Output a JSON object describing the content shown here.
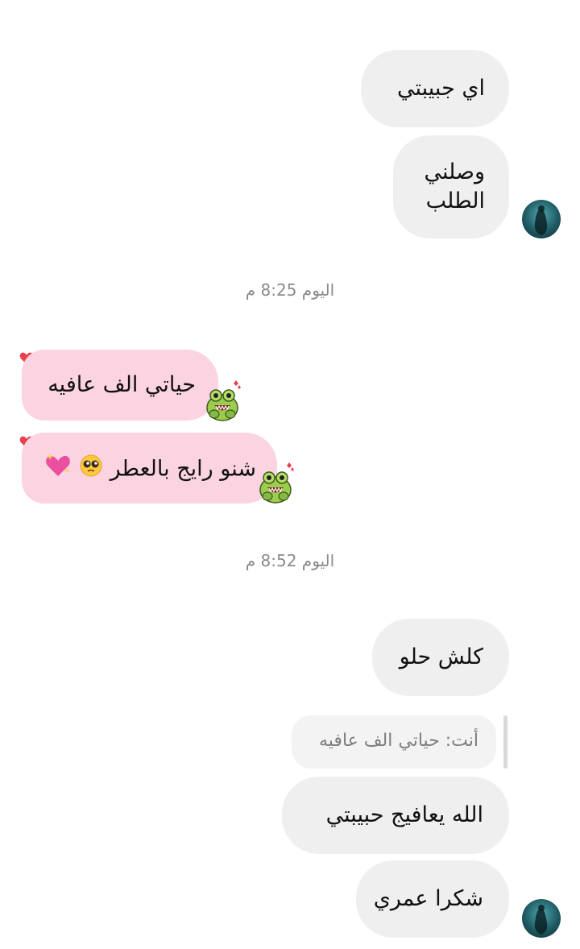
{
  "messages": [
    {
      "text": "اي جبيبتي"
    },
    {
      "line1": "وصلني",
      "line2": "الطلب"
    },
    {
      "text": "حياتي الف عافيه"
    },
    {
      "text": "شنو رايج بالعطر"
    },
    {
      "text": "كلش حلو"
    },
    {
      "reply_label": "أنت: حياتي الف عافيه"
    },
    {
      "text": "الله يعافيج حبيبتي"
    },
    {
      "text": "شكرا عمري"
    }
  ],
  "timestamps": [
    "اليوم 8:25 م",
    "اليوم 8:52 م"
  ],
  "icons": {
    "avatar": "profile-avatar",
    "sticker": "frog-sticker",
    "heart": "heart-reaction",
    "emoji_pleading": "pleading-face-emoji",
    "emoji_heart": "sparkling-heart-emoji"
  },
  "colors": {
    "incoming_bubble": "#efefef",
    "outgoing_bubble": "#fbd3e1",
    "timestamp_text": "#8a8a8a",
    "heart": "#e8414e"
  }
}
